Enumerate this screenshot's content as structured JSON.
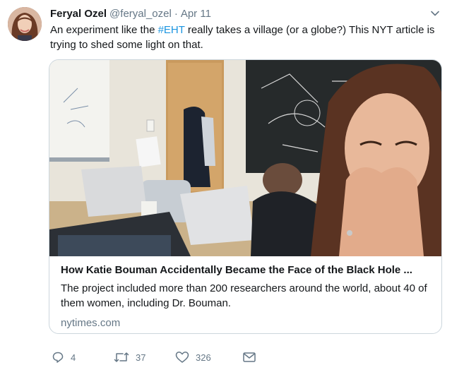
{
  "tweet": {
    "author_name": "Feryal Ozel",
    "author_handle": "@feryal_ozel",
    "separator": "·",
    "date": "Apr 11",
    "text_before": "An experiment like the ",
    "hashtag": "#EHT",
    "text_after": " really takes a village (or a globe?) This NYT article is trying to shed some light on that."
  },
  "card": {
    "title": "How Katie Bouman Accidentally Became the Face of the Black Hole ...",
    "description": "The project included more than 200 researchers around the world, about 40 of them women, including Dr. Bouman.",
    "domain": "nytimes.com"
  },
  "actions": {
    "replies": "4",
    "retweets": "37",
    "likes": "326"
  },
  "icons": {
    "reply": "reply-icon",
    "retweet": "retweet-icon",
    "like": "heart-icon",
    "dm": "envelope-icon",
    "menu": "chevron-down-icon"
  },
  "colors": {
    "hashtag": "#1b95e0",
    "secondary_text": "#657786",
    "card_border": "#ccd6dd"
  }
}
